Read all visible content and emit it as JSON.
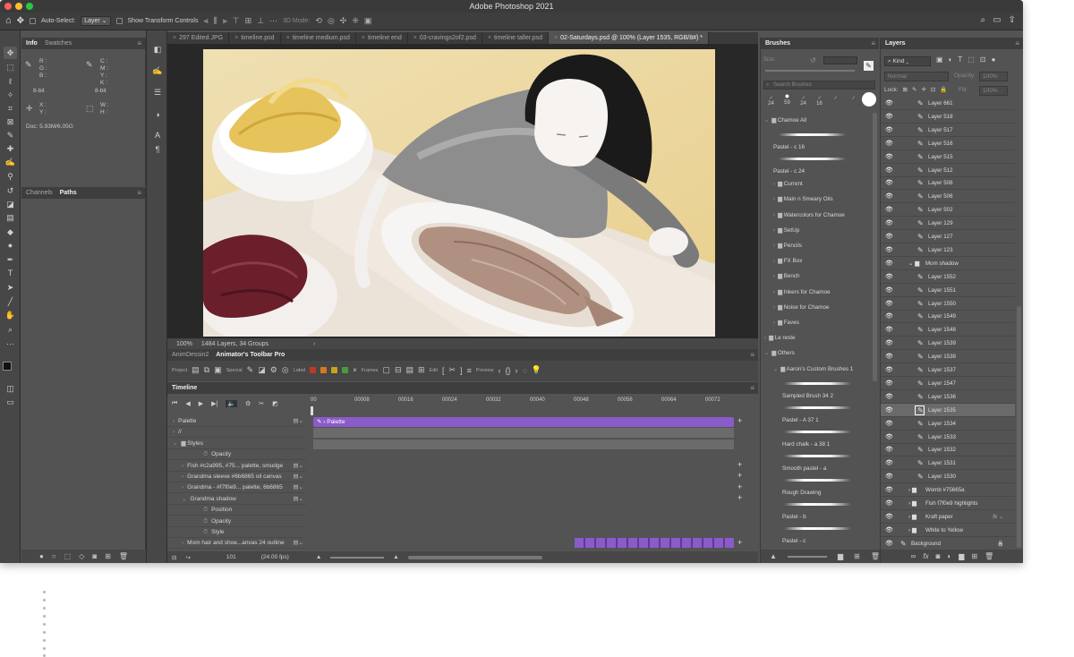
{
  "app": {
    "title": "Adobe Photoshop 2021"
  },
  "options": {
    "auto_select_label": "Auto-Select:",
    "auto_select_value": "Layer",
    "show_transform_label": "Show Transform Controls",
    "mode_3d_label": "3D Mode:"
  },
  "info_panel": {
    "tabs": [
      "Info",
      "Swatches"
    ],
    "rgb": [
      "R :",
      "G :",
      "B :"
    ],
    "cmyk": [
      "C :",
      "M :",
      "Y :",
      "K :"
    ],
    "bits_left": "8-bit",
    "bits_right": "8-bit",
    "xy": [
      "X :",
      "Y :"
    ],
    "wh": [
      "W :",
      "H :"
    ],
    "doc": "Doc: 5.93M/6.05G"
  },
  "paths_panel": {
    "tabs": [
      "Channels",
      "Paths"
    ]
  },
  "doc_tabs": [
    {
      "label": "297 Edited.JPG"
    },
    {
      "label": "timeline.psd"
    },
    {
      "label": "timeline medium.psd"
    },
    {
      "label": "timeline end"
    },
    {
      "label": "03-cravings2of2.psd"
    },
    {
      "label": "timeline taller.psd"
    },
    {
      "label": "02-Saturdays.psd @ 100% (Layer 1535, RGB/8#) *"
    }
  ],
  "status": {
    "zoom": "100%",
    "info": "1484 Layers, 34 Groups",
    "arrow": "›"
  },
  "animator": {
    "tabs": [
      "AnimDessin2",
      "Animator's Toolbar Pro"
    ],
    "labels": {
      "project": "Project",
      "special": "Special",
      "label": "Label",
      "frames": "Frames",
      "edit": "Edit",
      "preview": "Preview"
    },
    "label_colors": [
      "#c0392b",
      "#d17a22",
      "#c8a320",
      "#4a9a3a"
    ]
  },
  "timeline": {
    "tab": "Timeline",
    "ruler": [
      "00",
      "00008",
      "00016",
      "00024",
      "00032",
      "00040",
      "00048",
      "00056",
      "00064",
      "00072"
    ],
    "rows": [
      {
        "label": "Palette",
        "indent": 0,
        "chev": "›"
      },
      {
        "label": "//",
        "indent": 0,
        "chev": "›"
      },
      {
        "label": "Styles",
        "indent": 0,
        "chev": "⌄"
      },
      {
        "label": "Opacity",
        "indent": 2,
        "chev": ""
      },
      {
        "label": "Fish #c2a995, #75... palette, smudge",
        "indent": 1,
        "chev": "›"
      },
      {
        "label": "Grandma sleeve #6b6865 oil canvas",
        "indent": 1,
        "chev": "›"
      },
      {
        "label": "Grandma - #f7f0e9... palette, 6b6865",
        "indent": 1,
        "chev": "›"
      },
      {
        "label": "Grandma shadow",
        "indent": 1,
        "chev": "⌄"
      },
      {
        "label": "Position",
        "indent": 2,
        "chev": ""
      },
      {
        "label": "Opacity",
        "indent": 2,
        "chev": ""
      },
      {
        "label": "Style",
        "indent": 2,
        "chev": ""
      },
      {
        "label": "Mom hair and shoe...anvas 24 outline",
        "indent": 1,
        "chev": "›"
      }
    ],
    "clip_label": "Palette",
    "frame": "101",
    "fps": "(24.00 fps)"
  },
  "brushes": {
    "tab": "Brushes",
    "size_label": "Size:",
    "search_placeholder": "Search Brushes",
    "presets": [
      "24",
      "59",
      "24",
      "16",
      "",
      ""
    ],
    "rows": [
      {
        "label": "Chamoe All",
        "type": "folder",
        "chev": "⌄",
        "indent": 0
      },
      {
        "label": "Pastel - c 16",
        "type": "brush",
        "indent": 1
      },
      {
        "label": "Pastel - c 24",
        "type": "brush",
        "indent": 1
      },
      {
        "label": "Current",
        "type": "folder",
        "chev": "›",
        "indent": 1
      },
      {
        "label": "Main n Smeary Oils",
        "type": "folder",
        "chev": "›",
        "indent": 1
      },
      {
        "label": "Watercolors for Chamoe",
        "type": "folder",
        "chev": "›",
        "indent": 1
      },
      {
        "label": "SetUp",
        "type": "folder",
        "chev": "›",
        "indent": 1
      },
      {
        "label": "Pencils",
        "type": "folder",
        "chev": "›",
        "indent": 1
      },
      {
        "label": "FX Box",
        "type": "folder",
        "chev": "›",
        "indent": 1
      },
      {
        "label": "Bench",
        "type": "folder",
        "chev": "›",
        "indent": 1
      },
      {
        "label": "Inkers for Chamoe",
        "type": "folder",
        "chev": "›",
        "indent": 1
      },
      {
        "label": "Noise for Chamoe",
        "type": "folder",
        "chev": "›",
        "indent": 1
      },
      {
        "label": "Faves",
        "type": "folder",
        "chev": "›",
        "indent": 1
      },
      {
        "label": "Le reste",
        "type": "folder",
        "chev": "›",
        "indent": 0
      },
      {
        "label": "Others",
        "type": "folder",
        "chev": "⌄",
        "indent": 0
      },
      {
        "label": "Aaron's Custom Brushes 1",
        "type": "folder",
        "chev": "⌄",
        "indent": 1
      },
      {
        "label": "Sampled Brush 34 2",
        "type": "brush",
        "indent": 2
      },
      {
        "label": "Pastel - A 37 1",
        "type": "brush",
        "indent": 2
      },
      {
        "label": "Hard chalk - a 38 1",
        "type": "brush",
        "indent": 2
      },
      {
        "label": "Smooth pastel - a",
        "type": "brush",
        "indent": 2
      },
      {
        "label": "Rough Drawing",
        "type": "brush",
        "indent": 2
      },
      {
        "label": "Pastel - b",
        "type": "brush",
        "indent": 2
      },
      {
        "label": "Pastel - c",
        "type": "brush",
        "indent": 2
      }
    ]
  },
  "layers": {
    "tab": "Layers",
    "kind": "Kind",
    "blend": "Normal",
    "opacity_label": "Opacity:",
    "opacity_value": "100%",
    "lock_label": "Lock:",
    "fill_label": "Fill:",
    "fill_value": "100%",
    "rows": [
      {
        "name": "Layer 661",
        "type": "layer",
        "indent": 1,
        "sel": false
      },
      {
        "name": "Layer 518",
        "type": "layer",
        "indent": 1,
        "sel": false
      },
      {
        "name": "Layer 517",
        "type": "layer",
        "indent": 1,
        "sel": false
      },
      {
        "name": "Layer 516",
        "type": "layer",
        "indent": 1,
        "sel": false
      },
      {
        "name": "Layer 515",
        "type": "layer",
        "indent": 1,
        "sel": false
      },
      {
        "name": "Layer 512",
        "type": "layer",
        "indent": 1,
        "sel": false
      },
      {
        "name": "Layer 508",
        "type": "layer",
        "indent": 1,
        "sel": false
      },
      {
        "name": "Layer 506",
        "type": "layer",
        "indent": 1,
        "sel": false
      },
      {
        "name": "Layer 502",
        "type": "layer",
        "indent": 1,
        "sel": false
      },
      {
        "name": "Layer 129",
        "type": "layer",
        "indent": 1,
        "sel": false
      },
      {
        "name": "Layer 127",
        "type": "layer",
        "indent": 1,
        "sel": false
      },
      {
        "name": "Layer 123",
        "type": "layer",
        "indent": 1,
        "sel": false
      },
      {
        "name": "Mom shadow",
        "type": "group-open",
        "indent": 0,
        "sel": false
      },
      {
        "name": "Layer 1552",
        "type": "layer",
        "indent": 1,
        "sel": false
      },
      {
        "name": "Layer 1551",
        "type": "layer",
        "indent": 1,
        "sel": false
      },
      {
        "name": "Layer 1550",
        "type": "layer",
        "indent": 1,
        "sel": false
      },
      {
        "name": "Layer 1549",
        "type": "layer",
        "indent": 1,
        "sel": false
      },
      {
        "name": "Layer 1548",
        "type": "layer",
        "indent": 1,
        "sel": false
      },
      {
        "name": "Layer 1539",
        "type": "layer",
        "indent": 1,
        "sel": false
      },
      {
        "name": "Layer 1538",
        "type": "layer",
        "indent": 1,
        "sel": false
      },
      {
        "name": "Layer 1537",
        "type": "layer",
        "indent": 1,
        "sel": false
      },
      {
        "name": "Layer 1547",
        "type": "layer",
        "indent": 1,
        "sel": false
      },
      {
        "name": "Layer 1536",
        "type": "layer",
        "indent": 1,
        "sel": false
      },
      {
        "name": "Layer 1535",
        "type": "layer",
        "indent": 1,
        "sel": true
      },
      {
        "name": "Layer 1534",
        "type": "layer",
        "indent": 1,
        "sel": false
      },
      {
        "name": "Layer 1533",
        "type": "layer",
        "indent": 1,
        "sel": false
      },
      {
        "name": "Layer 1532",
        "type": "layer",
        "indent": 1,
        "sel": false
      },
      {
        "name": "Layer 1531",
        "type": "layer",
        "indent": 1,
        "sel": false
      },
      {
        "name": "Layer 1530",
        "type": "layer",
        "indent": 1,
        "sel": false
      },
      {
        "name": "Womb #75665a",
        "type": "group",
        "indent": 0,
        "sel": false
      },
      {
        "name": "Fish f7f0e9 highlights",
        "type": "group",
        "indent": 0,
        "sel": false
      },
      {
        "name": "Kraft paper",
        "type": "group-fx",
        "indent": 0,
        "sel": false
      },
      {
        "name": "White to Yellow",
        "type": "group",
        "indent": 0,
        "sel": false
      },
      {
        "name": "Background",
        "type": "background",
        "indent": 0,
        "sel": false
      }
    ]
  }
}
